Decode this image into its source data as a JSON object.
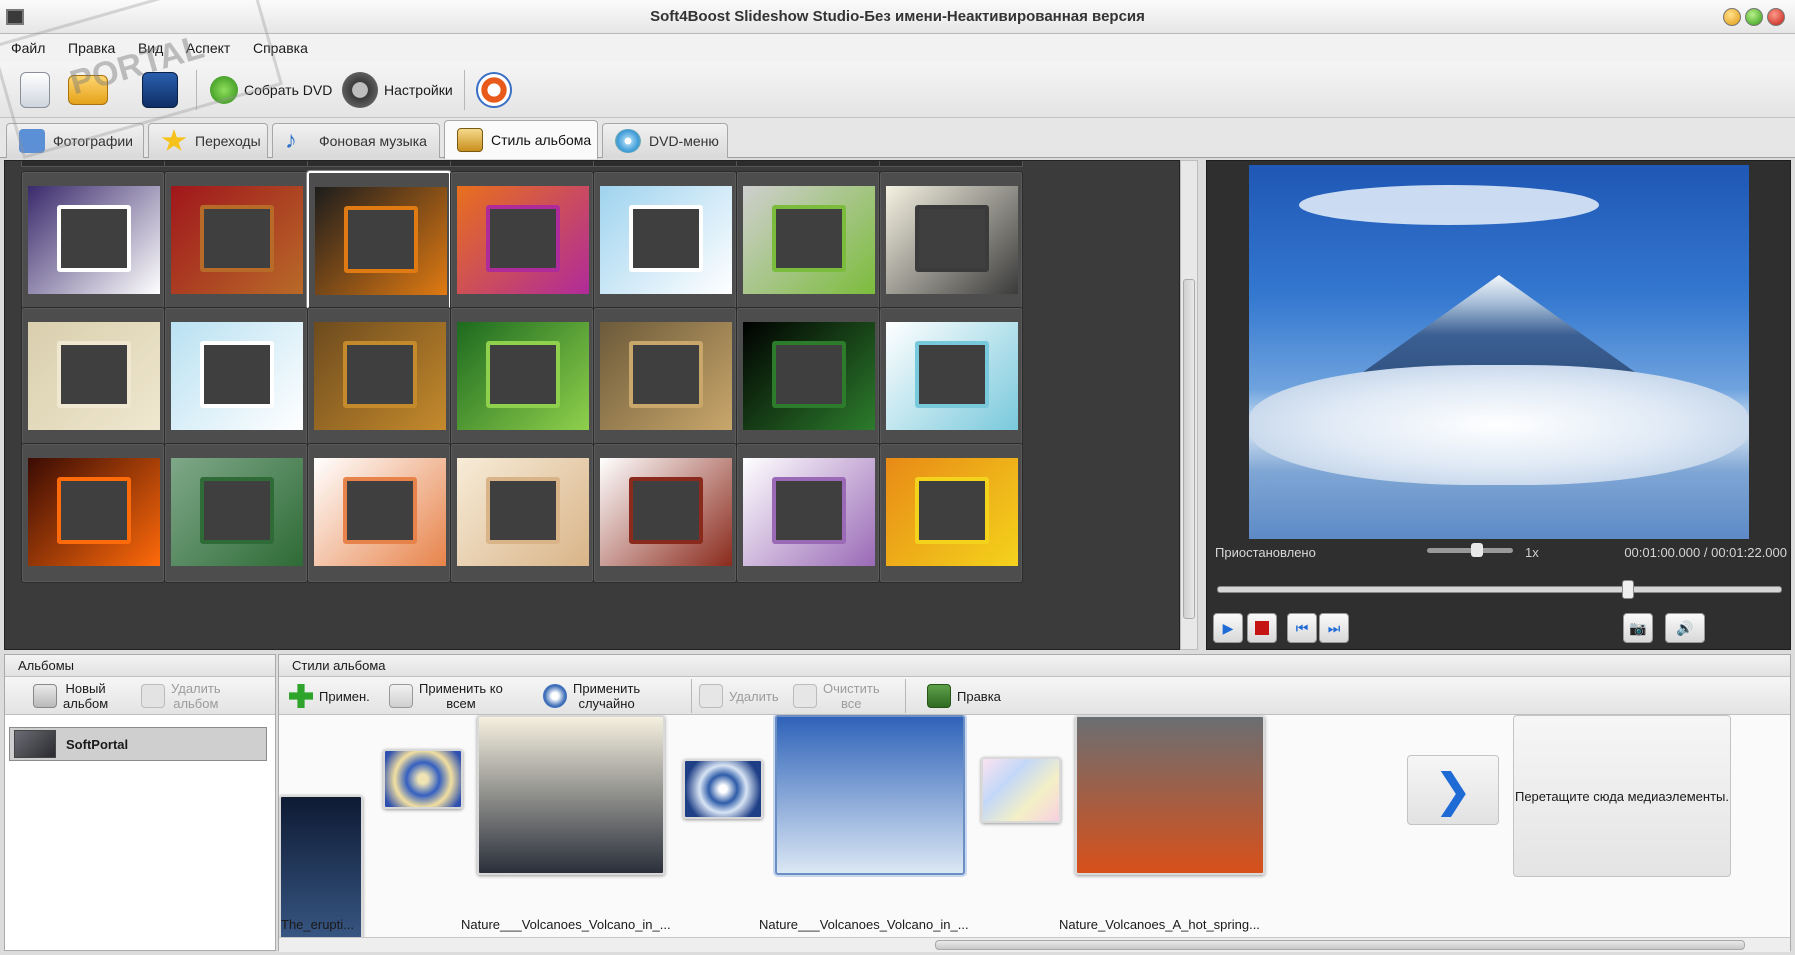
{
  "window": {
    "title": "Soft4Boost Slideshow Studio-Без имени-Неактивированная версия"
  },
  "menu": [
    "Файл",
    "Правка",
    "Вид",
    "Аспект",
    "Справка"
  ],
  "toolbar": {
    "burn_dvd_label": "Собрать DVD",
    "settings_label": "Настройки"
  },
  "tabs": [
    {
      "label": "Фотографии",
      "active": false,
      "color": "#5b8fd6"
    },
    {
      "label": "Переходы",
      "active": false,
      "color": "#f5c21b"
    },
    {
      "label": "Фоновая музыка",
      "active": false,
      "color": "#2c6fc9"
    },
    {
      "label": "Стиль альбома",
      "active": true,
      "color": "#e9b84a"
    },
    {
      "label": "DVD-меню",
      "active": false,
      "color": "#3c9ad8"
    }
  ],
  "styles_grid": {
    "rows": [
      [
        {
          "style": "winter",
          "bg": "#3a2a6c",
          "accent": "#ffffff"
        },
        {
          "style": "wood-red",
          "bg": "#a0161c",
          "accent": "#b86a28"
        },
        {
          "style": "autumn-leaves",
          "bg": "#1d1d1d",
          "accent": "#e07a12",
          "selected": true
        },
        {
          "style": "orange-purple",
          "bg": "#e8701c",
          "accent": "#b02b9a"
        },
        {
          "style": "pinned-photo",
          "bg": "#9fd3ef",
          "accent": "#ffffff"
        },
        {
          "style": "palms",
          "bg": "#cfcfcf",
          "accent": "#7cbc3c"
        },
        {
          "style": "torn-paper",
          "bg": "#f5f2e2",
          "accent": "#3b3b3b"
        }
      ],
      [
        {
          "style": "old-paper",
          "bg": "#d9cfae",
          "accent": "#efe7cf"
        },
        {
          "style": "snowflakes",
          "bg": "#b9e1f2",
          "accent": "#ffffff"
        },
        {
          "style": "leaves-oval",
          "bg": "#6d4b1e",
          "accent": "#c58a2c"
        },
        {
          "style": "green-flowers",
          "bg": "#1d6a1f",
          "accent": "#8fd04c"
        },
        {
          "style": "gold-frame",
          "bg": "#6c5a3a",
          "accent": "#c9a76b"
        },
        {
          "style": "binocular",
          "bg": "#000000",
          "accent": "#2c7c2c"
        },
        {
          "style": "pets",
          "bg": "#ffffff",
          "accent": "#79c9dc"
        }
      ],
      [
        {
          "style": "fire",
          "bg": "#3a0b04",
          "accent": "#ff6a0a"
        },
        {
          "style": "butterflies",
          "bg": "#7fa889",
          "accent": "#2e6b36"
        },
        {
          "style": "orange-frame",
          "bg": "#ffffff",
          "accent": "#e7834a"
        },
        {
          "style": "fish",
          "bg": "#f7ecd8",
          "accent": "#d9b488"
        },
        {
          "style": "red-wood-frame",
          "bg": "#ffffff",
          "accent": "#8a2a1c"
        },
        {
          "style": "flower-corner",
          "bg": "#ffffff",
          "accent": "#9a6ab6"
        },
        {
          "style": "retro-tv",
          "bg": "#e88a16",
          "accent": "#f4d31c"
        }
      ]
    ]
  },
  "preview": {
    "status": "Приостановлено",
    "speed": "1x",
    "time_current": "00:01:00.000",
    "time_separator": "/",
    "time_total": "00:01:22.000",
    "seek_fraction": 0.73
  },
  "albums": {
    "title": "Альбомы",
    "new_album": "Новый\nальбом",
    "delete_album": "Удалить\nальбом",
    "items": [
      "SoftPortal"
    ]
  },
  "album_styles": {
    "title": "Стили альбома",
    "apply": "Примен.",
    "apply_all": "Применить ко\nвсем",
    "apply_random": "Применить\nслучайно",
    "delete": "Удалить",
    "clear_all": "Очистить\nвсе",
    "edit": "Правка"
  },
  "timeline": {
    "slides": [
      {
        "name": "The_erupti...",
        "colors": [
          "#0e1a33",
          "#3b5c8a"
        ]
      },
      {
        "name": "Nature___Volcanoes_Volcano_in_...",
        "colors": [
          "#f5f0df",
          "#2a2f3a"
        ]
      },
      {
        "name": "Nature___Volcanoes_Volcano_in_...",
        "colors": [
          "#2f63b9",
          "#dbe7f4"
        ],
        "selected": true
      },
      {
        "name": "Nature_Volcanoes_A_hot_spring...",
        "colors": [
          "#6a6e72",
          "#d8501a"
        ]
      }
    ],
    "dropzone": "Перетащите сюда медиаэлементы."
  },
  "watermark": "PORTAL"
}
